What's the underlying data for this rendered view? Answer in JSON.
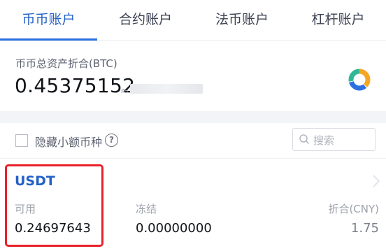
{
  "tabs": [
    {
      "label": "币币账户",
      "active": true
    },
    {
      "label": "合约账户",
      "active": false
    },
    {
      "label": "法币账户",
      "active": false
    },
    {
      "label": "杠杆账户",
      "active": false
    }
  ],
  "summary": {
    "label": "币币总资产折合(BTC)",
    "value": "0.45375152",
    "approx_symbol": "≈"
  },
  "filter": {
    "hide_small_label": "隐藏小额币种",
    "help_glyph": "?",
    "search_placeholder": "搜索"
  },
  "asset": {
    "coin": "USDT",
    "available_label": "可用",
    "available_value": "0.24697643",
    "frozen_label": "冻结",
    "frozen_value": "0.00000000",
    "converted_label": "折合(CNY)",
    "converted_value": "1.75"
  },
  "colors": {
    "accent": "#2461c6",
    "highlight": "#e8212a",
    "pie_orange": "#f5a623",
    "pie_blue": "#2b6fe0",
    "pie_green": "#2fb896"
  }
}
